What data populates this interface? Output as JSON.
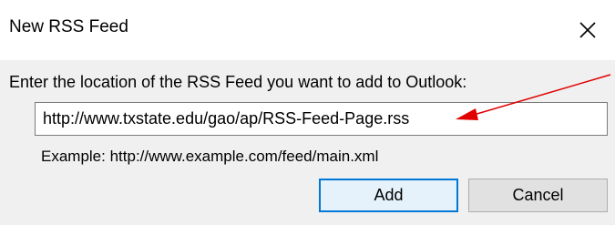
{
  "dialog": {
    "title": "New RSS Feed",
    "prompt": "Enter the location of the RSS Feed you want to add to Outlook:",
    "url_value": "http://www.txstate.edu/gao/ap/RSS-Feed-Page.rss",
    "example": "Example: http://www.example.com/feed/main.xml",
    "add_label": "Add",
    "cancel_label": "Cancel",
    "close_icon": "close-icon"
  },
  "annotation": {
    "arrow_color": "#e00000"
  },
  "colors": {
    "primary_border": "#0078d7",
    "primary_bg": "#e5f1fb",
    "background": "#f0f0f0"
  }
}
